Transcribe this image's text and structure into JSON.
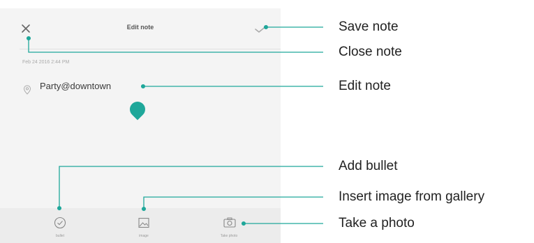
{
  "screen": {
    "title": "Edit note",
    "timestamp": "Feb 24 2016 2:44 PM",
    "note_text": "Party@downtown",
    "accent_color": "#1fa79a",
    "icons": {
      "close": "close-icon",
      "save": "checkmark-icon",
      "location": "location-pin-icon"
    },
    "toolbar": [
      {
        "label": "bullet",
        "icon": "checkbox-circle-icon"
      },
      {
        "label": "image",
        "icon": "image-icon"
      },
      {
        "label": "Take photo",
        "icon": "camera-icon"
      }
    ]
  },
  "callouts": {
    "save_note": "Save note",
    "close_note": "Close note",
    "edit_note": "Edit note",
    "add_bullet": "Add bullet",
    "insert_image": "Insert image from gallery",
    "take_photo": "Take a photo"
  }
}
